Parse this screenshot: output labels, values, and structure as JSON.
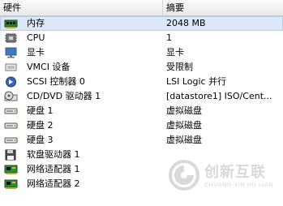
{
  "table": {
    "headers": {
      "hardware": "硬件",
      "summary": "摘要"
    },
    "rows": [
      {
        "icon": "memory-icon",
        "name": "内存",
        "summary": "2048 MB",
        "selected": true
      },
      {
        "icon": "cpu-icon",
        "name": "CPU",
        "summary": "1"
      },
      {
        "icon": "display-icon",
        "name": "显卡",
        "summary": "显卡"
      },
      {
        "icon": "vmci-device-icon",
        "name": "VMCI 设备",
        "summary": "受限制"
      },
      {
        "icon": "scsi-controller-icon",
        "name": "SCSI 控制器 0",
        "summary": "LSI Logic 并行"
      },
      {
        "icon": "cd-dvd-drive-icon",
        "name": "CD/DVD 驱动器 1",
        "summary": "[datastore1] ISO/Cent..."
      },
      {
        "icon": "hard-disk-icon",
        "name": "硬盘 1",
        "summary": "虚拟磁盘"
      },
      {
        "icon": "hard-disk-icon",
        "name": "硬盘 2",
        "summary": "虚拟磁盘"
      },
      {
        "icon": "hard-disk-icon",
        "name": "硬盘 3",
        "summary": "虚拟磁盘"
      },
      {
        "icon": "floppy-drive-icon",
        "name": "软盘驱动器 1",
        "summary": ""
      },
      {
        "icon": "network-adapter-icon",
        "name": "网络适配器 1",
        "summary": ""
      },
      {
        "icon": "network-adapter-icon",
        "name": "网络适配器 2",
        "summary": ""
      }
    ]
  },
  "watermark": {
    "title": "创新互联",
    "subtitle": "CHUANG XIN HU LIAN"
  },
  "colors": {
    "selected_row": "#dde8f7",
    "watermark": "#d9d9d9"
  }
}
